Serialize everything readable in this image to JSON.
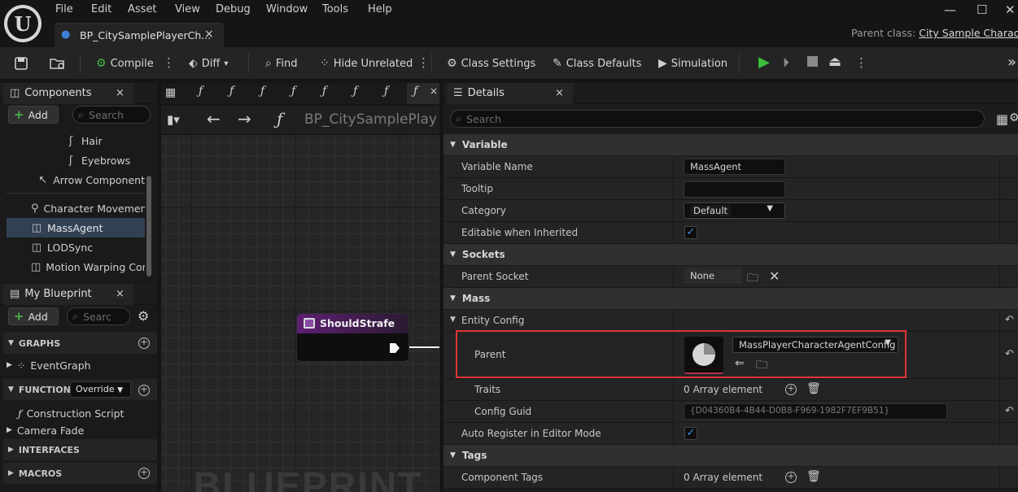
{
  "menu": [
    "File",
    "Edit",
    "Asset",
    "View",
    "Debug",
    "Window",
    "Tools",
    "Help"
  ],
  "tab": {
    "label": "BP_CitySamplePlayerCh...",
    "close": "×"
  },
  "window_controls": {
    "minimize": "—",
    "maximize": "☐",
    "close": "✕"
  },
  "parent_class": {
    "label": "Parent class:",
    "value": "City Sample Characte"
  },
  "toolbar": {
    "compile": "Compile",
    "diff": "Diff",
    "find": "Find",
    "hide_unrelated": "Hide Unrelated",
    "class_settings": "Class Settings",
    "class_defaults": "Class Defaults",
    "simulation": "Simulation"
  },
  "components": {
    "title": "Components",
    "close": "×",
    "add": "Add",
    "search_placeholder": "Search",
    "items": [
      {
        "label": "Hair",
        "icon": "hair-icon",
        "selected": false
      },
      {
        "label": "Eyebrows",
        "icon": "hair-icon",
        "selected": false
      },
      {
        "label": "Arrow Component",
        "icon": "arrow-icon",
        "selected": false
      },
      {
        "label": "Character Movemen",
        "icon": "movement-icon",
        "selected": false
      },
      {
        "label": "MassAgent",
        "icon": "component-icon",
        "selected": true
      },
      {
        "label": "LODSync",
        "icon": "component-icon",
        "selected": false
      },
      {
        "label": "Motion Warping Com",
        "icon": "component-icon",
        "selected": false
      }
    ]
  },
  "my_blueprint": {
    "title": "My Blueprint",
    "close": "×",
    "add": "Add",
    "search_placeholder": "Searc",
    "sections": {
      "graphs": "GRAPHS",
      "functions": "FUNCTIONS",
      "override": "Override",
      "interfaces": "INTERFACES",
      "macros": "MACROS"
    },
    "event_graph": "EventGraph",
    "construction_script": "Construction Script",
    "camera_fade": "Camera Fade"
  },
  "graph": {
    "breadcrumb": "BP_CitySamplePlay",
    "node_title": "ShouldStrafe",
    "watermark": "BLUEPRINT"
  },
  "details": {
    "title": "Details",
    "close": "×",
    "search_placeholder": "Search",
    "categories": {
      "variable": "Variable",
      "sockets": "Sockets",
      "mass": "Mass",
      "tags": "Tags"
    },
    "rows": {
      "variable_name": {
        "label": "Variable Name",
        "value": "MassAgent"
      },
      "tooltip": {
        "label": "Tooltip",
        "value": ""
      },
      "category": {
        "label": "Category",
        "value": "Default"
      },
      "editable_inherited": {
        "label": "Editable when Inherited",
        "checked": true
      },
      "parent_socket": {
        "label": "Parent Socket",
        "value": "None"
      },
      "entity_config": {
        "label": "Entity Config"
      },
      "parent": {
        "label": "Parent",
        "value": "MassPlayerCharacterAgentConfig"
      },
      "traits": {
        "label": "Traits",
        "value": "0 Array element"
      },
      "config_guid": {
        "label": "Config Guid",
        "value": "{D04360B4-4B44-D0B8-F969-1982F7EF9B51}"
      },
      "auto_register": {
        "label": "Auto Register in Editor Mode",
        "checked": true
      },
      "component_tags": {
        "label": "Component Tags",
        "value": "0 Array element"
      }
    }
  },
  "colors": {
    "selection": "#324053",
    "highlight_box": "#e03636",
    "node_header": "#5e1f72",
    "play": "#3cbf3c"
  }
}
